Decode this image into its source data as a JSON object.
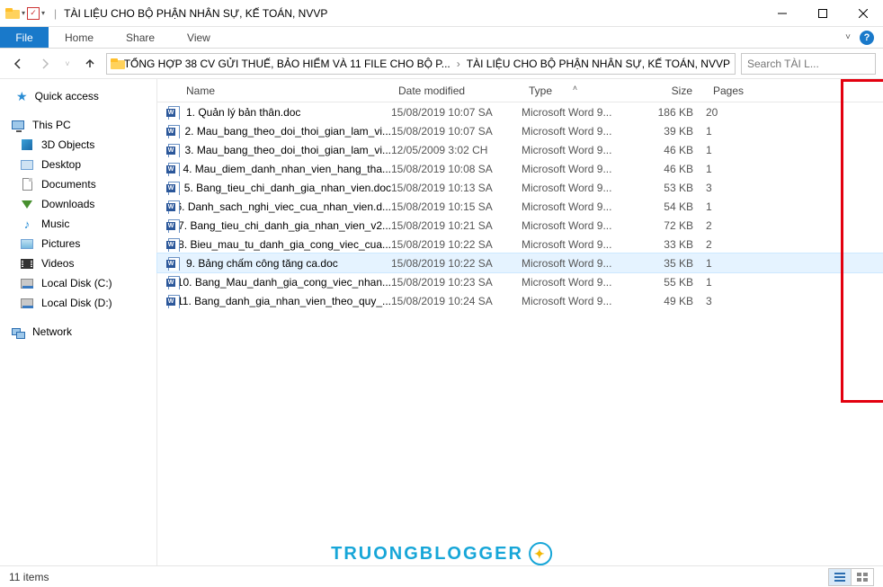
{
  "titlebar": {
    "title": "TÀI LIỆU CHO BỘ PHẬN NHÂN SỰ, KẾ TOÁN, NVVP",
    "separator": "|"
  },
  "ribbon": {
    "file": "File",
    "home": "Home",
    "share": "Share",
    "view": "View"
  },
  "address": {
    "prefix": "«",
    "crumb1": "TỔNG HỢP 38 CV GỬI THUẾ, BẢO HIỂM VÀ 11 FILE CHO BỘ P...",
    "crumb2": "TÀI LIỆU CHO BỘ PHẬN NHÂN SỰ, KẾ TOÁN, NVVP"
  },
  "search": {
    "placeholder": "Search TÀI L..."
  },
  "sidebar": {
    "quick": "Quick access",
    "thispc": "This PC",
    "items": [
      {
        "label": "3D Objects"
      },
      {
        "label": "Desktop"
      },
      {
        "label": "Documents"
      },
      {
        "label": "Downloads"
      },
      {
        "label": "Music"
      },
      {
        "label": "Pictures"
      },
      {
        "label": "Videos"
      },
      {
        "label": "Local Disk (C:)"
      },
      {
        "label": "Local Disk (D:)"
      }
    ],
    "network": "Network"
  },
  "columns": {
    "name": "Name",
    "date": "Date modified",
    "type": "Type",
    "size": "Size",
    "pages": "Pages"
  },
  "files": [
    {
      "name": "1. Quản lý bản thân.doc",
      "date": "15/08/2019 10:07 SA",
      "type": "Microsoft Word 9...",
      "size": "186 KB",
      "pages": "20",
      "selected": false
    },
    {
      "name": "2. Mau_bang_theo_doi_thoi_gian_lam_vi...",
      "date": "15/08/2019 10:07 SA",
      "type": "Microsoft Word 9...",
      "size": "39 KB",
      "pages": "1",
      "selected": false
    },
    {
      "name": "3. Mau_bang_theo_doi_thoi_gian_lam_vi...",
      "date": "12/05/2009 3:02 CH",
      "type": "Microsoft Word 9...",
      "size": "46 KB",
      "pages": "1",
      "selected": false
    },
    {
      "name": "4. Mau_diem_danh_nhan_vien_hang_tha...",
      "date": "15/08/2019 10:08 SA",
      "type": "Microsoft Word 9...",
      "size": "46 KB",
      "pages": "1",
      "selected": false
    },
    {
      "name": "5. Bang_tieu_chi_danh_gia_nhan_vien.doc",
      "date": "15/08/2019 10:13 SA",
      "type": "Microsoft Word 9...",
      "size": "53 KB",
      "pages": "3",
      "selected": false
    },
    {
      "name": "6. Danh_sach_nghi_viec_cua_nhan_vien.d...",
      "date": "15/08/2019 10:15 SA",
      "type": "Microsoft Word 9...",
      "size": "54 KB",
      "pages": "1",
      "selected": false
    },
    {
      "name": "7. Bang_tieu_chi_danh_gia_nhan_vien_v2...",
      "date": "15/08/2019 10:21 SA",
      "type": "Microsoft Word 9...",
      "size": "72 KB",
      "pages": "2",
      "selected": false
    },
    {
      "name": "8. Bieu_mau_tu_danh_gia_cong_viec_cua...",
      "date": "15/08/2019 10:22 SA",
      "type": "Microsoft Word 9...",
      "size": "33 KB",
      "pages": "2",
      "selected": false
    },
    {
      "name": "9. Bảng chấm công tăng ca.doc",
      "date": "15/08/2019 10:22 SA",
      "type": "Microsoft Word 9...",
      "size": "35 KB",
      "pages": "1",
      "selected": true
    },
    {
      "name": "10. Bang_Mau_danh_gia_cong_viec_nhan...",
      "date": "15/08/2019 10:23 SA",
      "type": "Microsoft Word 9...",
      "size": "55 KB",
      "pages": "1",
      "selected": false
    },
    {
      "name": "11. Bang_danh_gia_nhan_vien_theo_quy_...",
      "date": "15/08/2019 10:24 SA",
      "type": "Microsoft Word 9...",
      "size": "49 KB",
      "pages": "3",
      "selected": false
    }
  ],
  "status": {
    "count": "11 items"
  },
  "watermark": {
    "text": "TRUONGBLOGGER"
  }
}
